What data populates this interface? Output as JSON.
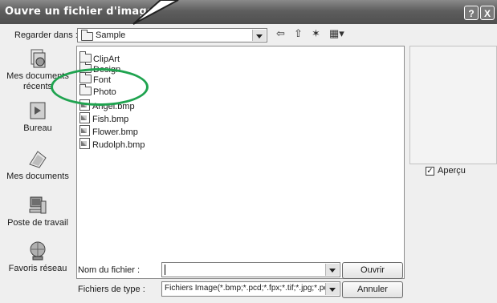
{
  "window": {
    "title": "Ouvre un fichier d'image",
    "help_glyph": "?",
    "close_glyph": "X"
  },
  "toolbar": {
    "lookin_label": "Regarder dans :",
    "lookin_value": "Sample",
    "back_glyph": "⇦",
    "up_glyph": "⇧",
    "newfolder_glyph": "✶",
    "views_glyph": "▦▾"
  },
  "places": [
    {
      "label": "Mes documents récents",
      "icon": "recent-documents-icon"
    },
    {
      "label": "Bureau",
      "icon": "desktop-icon"
    },
    {
      "label": "Mes documents",
      "icon": "my-documents-icon"
    },
    {
      "label": "Poste de travail",
      "icon": "my-computer-icon"
    },
    {
      "label": "Favoris réseau",
      "icon": "network-places-icon"
    }
  ],
  "files": [
    {
      "name": "ClipArt",
      "type": "folder"
    },
    {
      "name": "Design",
      "type": "folder"
    },
    {
      "name": "Font",
      "type": "folder"
    },
    {
      "name": "Photo",
      "type": "folder"
    },
    {
      "name": "Angel.bmp",
      "type": "bmp"
    },
    {
      "name": "Fish.bmp",
      "type": "bmp"
    },
    {
      "name": "Flower.bmp",
      "type": "bmp"
    },
    {
      "name": "Rudolph.bmp",
      "type": "bmp"
    }
  ],
  "preview": {
    "checkbox_label": "Aperçu",
    "checked": true
  },
  "footer": {
    "filename_label": "Nom du fichier :",
    "filename_value": "",
    "filetype_label": "Fichiers de type :",
    "filetype_value": "Fichiers Image(*.bmp;*.pcd;*.fpx;*.tif;*.jpg;*.pcx;",
    "open_button": "Ouvrir",
    "cancel_button": "Annuler"
  },
  "annotation": {
    "highlight_color": "#1fa34f"
  }
}
